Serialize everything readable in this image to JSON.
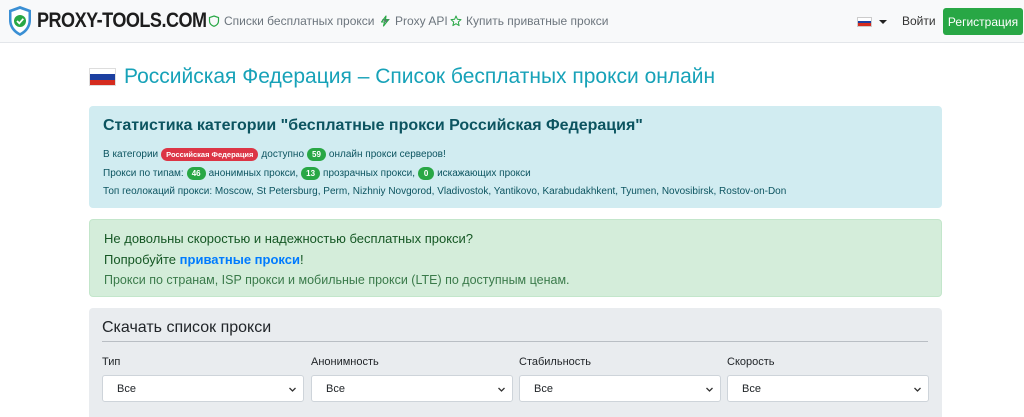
{
  "nav": {
    "brand": "PROXY-TOOLS.COM",
    "links": [
      {
        "label": "Списки бесплатных прокси"
      },
      {
        "label": "Proxy API"
      },
      {
        "label": "Купить приватные прокси"
      }
    ],
    "login": "Войти",
    "register": "Регистрация"
  },
  "page": {
    "title": "Российская Федерация – Список бесплатных прокси онлайн"
  },
  "stats": {
    "heading": "Статистика категории \"бесплатные прокси Российская Федерация\"",
    "line1_prefix": "В категории",
    "category_badge": "Российская Федерация",
    "line1_mid": "доступно",
    "online_count": "59",
    "line1_suffix": "онлайн прокси серверов!",
    "line2_prefix": "Прокси по типам:",
    "anonymous_count": "46",
    "anonymous_label": "анонимных прокси,",
    "transparent_count": "13",
    "transparent_label": "прозрачных прокси,",
    "distorting_count": "0",
    "distorting_label": "искажающих прокси",
    "line3": "Топ геолокаций прокси: Moscow, St Petersburg, Perm, Nizhniy Novgorod, Vladivostok, Yantikovo, Karabudakhkent, Tyumen, Novosibirsk, Rostov-on-Don"
  },
  "promo": {
    "question": "Не довольны скоростью и надежностью бесплатных прокси?",
    "try_prefix": "Попробуйте",
    "try_link": "приватные прокси",
    "try_suffix": "!",
    "description": "Прокси по странам, ISP прокси и мобильные прокси (LTE) по доступным ценам."
  },
  "download": {
    "heading": "Скачать список прокси",
    "filters": [
      {
        "label": "Тип",
        "value": "Все"
      },
      {
        "label": "Анонимность",
        "value": "Все"
      },
      {
        "label": "Стабильность",
        "value": "Все"
      },
      {
        "label": "Скорость",
        "value": "Все"
      }
    ]
  },
  "colors": {
    "accent": "#17a2b8",
    "success": "#28a745",
    "danger": "#dc3545",
    "link": "#007bff"
  }
}
